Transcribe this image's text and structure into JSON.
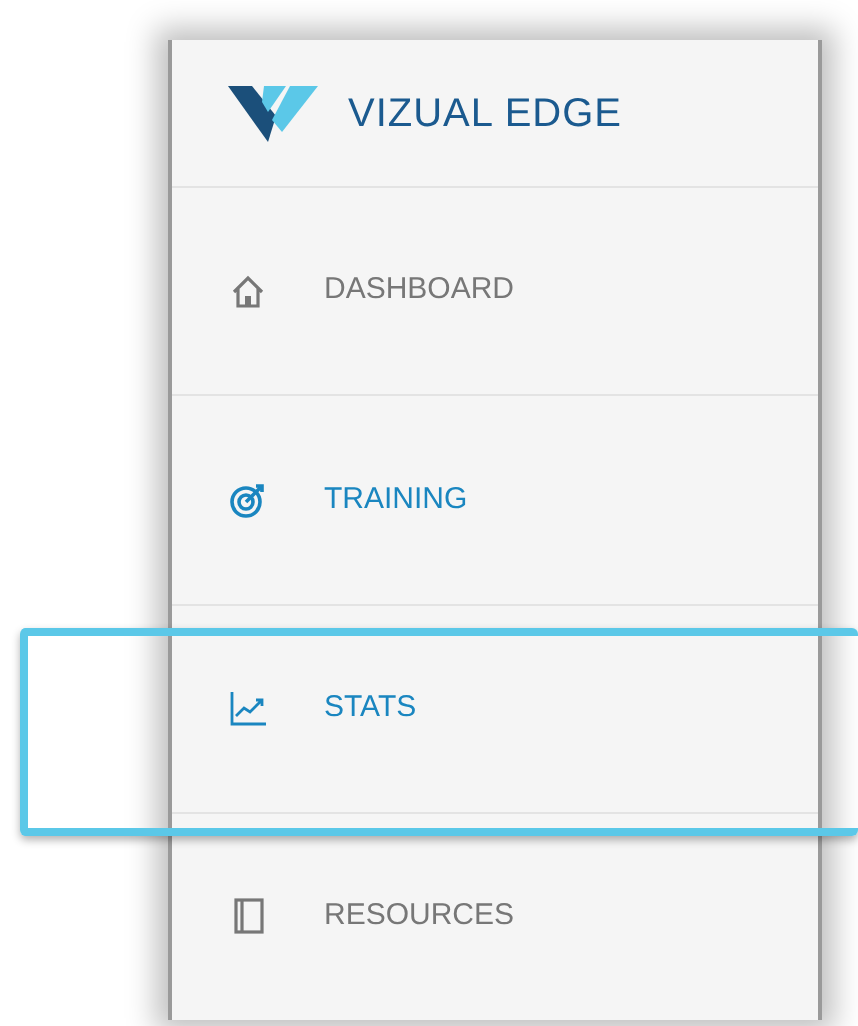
{
  "brand": {
    "name": "VIZUAL EDGE"
  },
  "nav": {
    "items": [
      {
        "label": "DASHBOARD",
        "selected": false,
        "highlighted": false
      },
      {
        "label": "TRAINING",
        "selected": true,
        "highlighted": false
      },
      {
        "label": "STATS",
        "selected": true,
        "highlighted": true
      },
      {
        "label": "RESOURCES",
        "selected": false,
        "highlighted": false
      }
    ]
  }
}
